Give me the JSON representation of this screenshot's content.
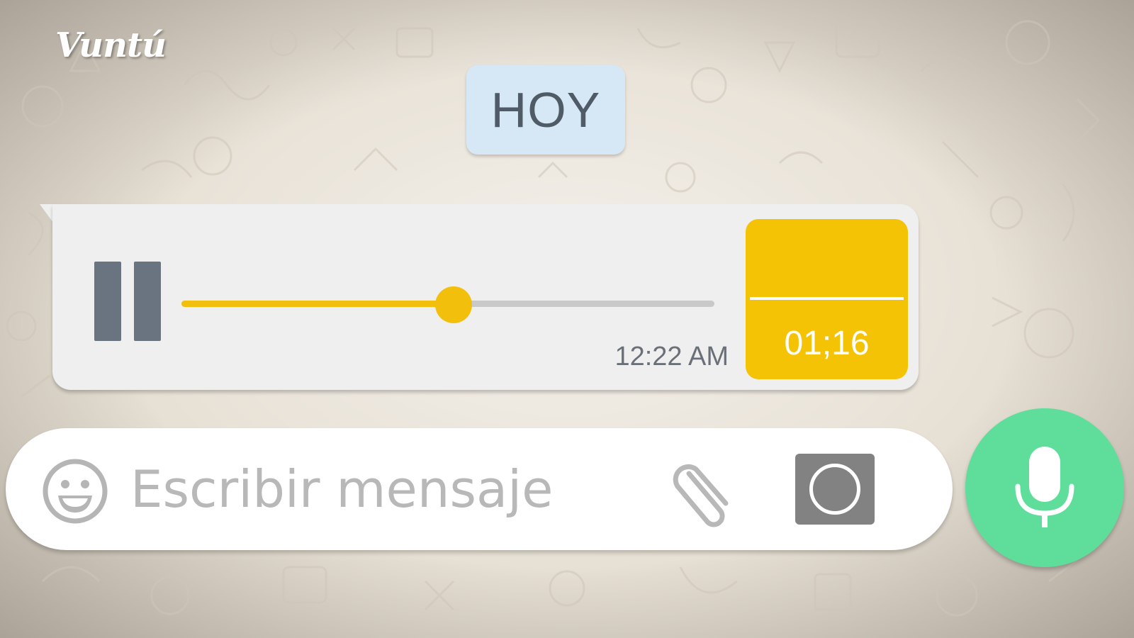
{
  "brand": {
    "logo_text": "Vuntú"
  },
  "chat": {
    "date_separator": "HOY",
    "voice_message": {
      "sent_time": "12:22 AM",
      "duration": "01;16",
      "progress": 0.51,
      "state_icon": "pause-icon"
    }
  },
  "composer": {
    "placeholder": "Escribir mensaje",
    "icons": [
      "emoji-icon",
      "paperclip-icon",
      "camera-icon",
      "microphone-icon"
    ]
  },
  "colors": {
    "accent": "#f2c00c",
    "mic_button": "#5fde9b",
    "date_badge": "#d6e8f5",
    "bubble": "#efefef"
  }
}
